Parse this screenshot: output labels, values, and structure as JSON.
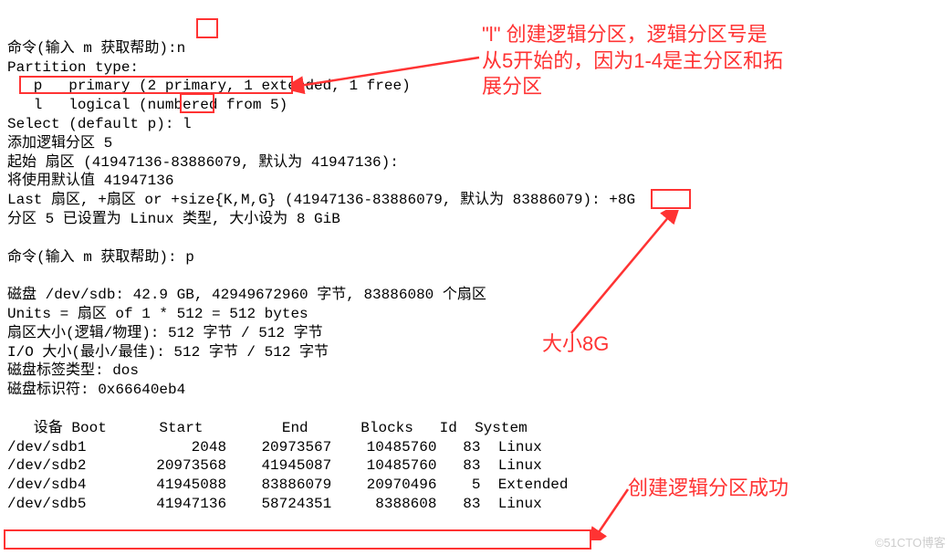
{
  "terminal": {
    "line01a": "命令(输入 m 获取帮助):",
    "line01b": "n",
    "line02": "Partition type:",
    "line03": "   p   primary (2 primary, 1 extended, 1 free)",
    "line04": "   l   logical (numbered from 5)",
    "line05a": "Select (default p): ",
    "line05b": "l",
    "line06": "添加逻辑分区 5",
    "line07": "起始 扇区 (41947136-83886079, 默认为 41947136):",
    "line08": "将使用默认值 41947136",
    "line09a": "Last 扇区, +扇区 or +size{K,M,G} (41947136-83886079, 默认为 83886079): ",
    "line09b": "+8G",
    "line10": "分区 5 已设置为 Linux 类型, 大小设为 8 GiB",
    "line11": "",
    "line12": "命令(输入 m 获取帮助): p",
    "line13": "",
    "line14": "磁盘 /dev/sdb: 42.9 GB, 42949672960 字节, 83886080 个扇区",
    "line15": "Units = 扇区 of 1 * 512 = 512 bytes",
    "line16": "扇区大小(逻辑/物理): 512 字节 / 512 字节",
    "line17": "I/O 大小(最小/最佳): 512 字节 / 512 字节",
    "line18": "磁盘标签类型: dos",
    "line19": "磁盘标识符: 0x66640eb4",
    "line20": "",
    "table_header": "   设备 Boot      Start         End      Blocks   Id  System",
    "row1": "/dev/sdb1            2048    20973567    10485760   83  Linux",
    "row2": "/dev/sdb2        20973568    41945087    10485760   83  Linux",
    "row3": "/dev/sdb4        41945088    83886079    20970496    5  Extended",
    "row4": "/dev/sdb5        41947136    58724351     8388608   83  Linux"
  },
  "annotations": {
    "a1": "\"l\" 创建逻辑分区，逻辑分区号是\n从5开始的，因为1-4是主分区和拓\n展分区",
    "a2": "大小8G",
    "a3": "创建逻辑分区成功"
  },
  "watermark": "©51CTO博客"
}
